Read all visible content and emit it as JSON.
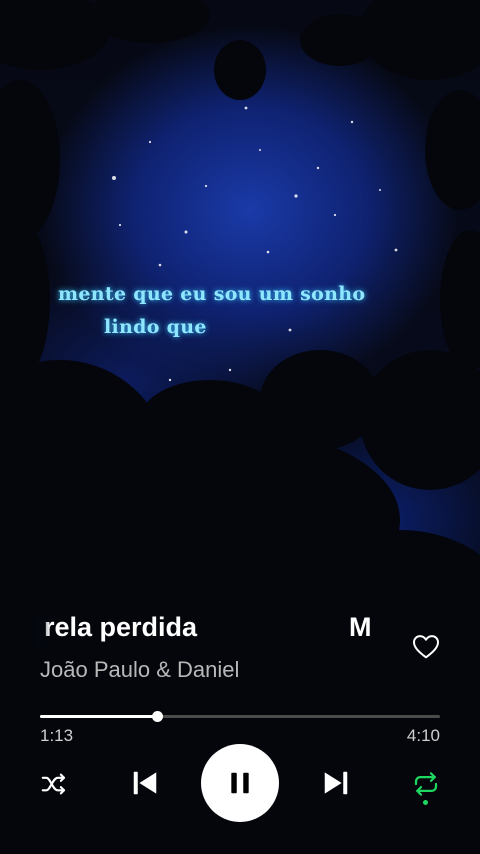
{
  "lyrics": {
    "line1": "mente que eu sou um sonho",
    "line2_sung": "lindo que",
    "line2_pending": ""
  },
  "track": {
    "title": "rela perdida",
    "title_next_fragment": "M",
    "artist": "João Paulo & Daniel",
    "liked": false
  },
  "playback": {
    "elapsed": "1:13",
    "total": "4:10",
    "progress_fraction": 0.292,
    "state": "playing",
    "shuffle": false,
    "repeat": true
  },
  "icons": {
    "heart": "heart-outline-icon",
    "shuffle": "shuffle-icon",
    "previous": "skip-previous-icon",
    "pause": "pause-icon",
    "next": "skip-next-icon",
    "repeat": "repeat-icon"
  },
  "colors": {
    "lyric_highlight": "#8fe6ff",
    "accent_green": "#1ed760",
    "sky_blue": "#1a3aa8"
  }
}
